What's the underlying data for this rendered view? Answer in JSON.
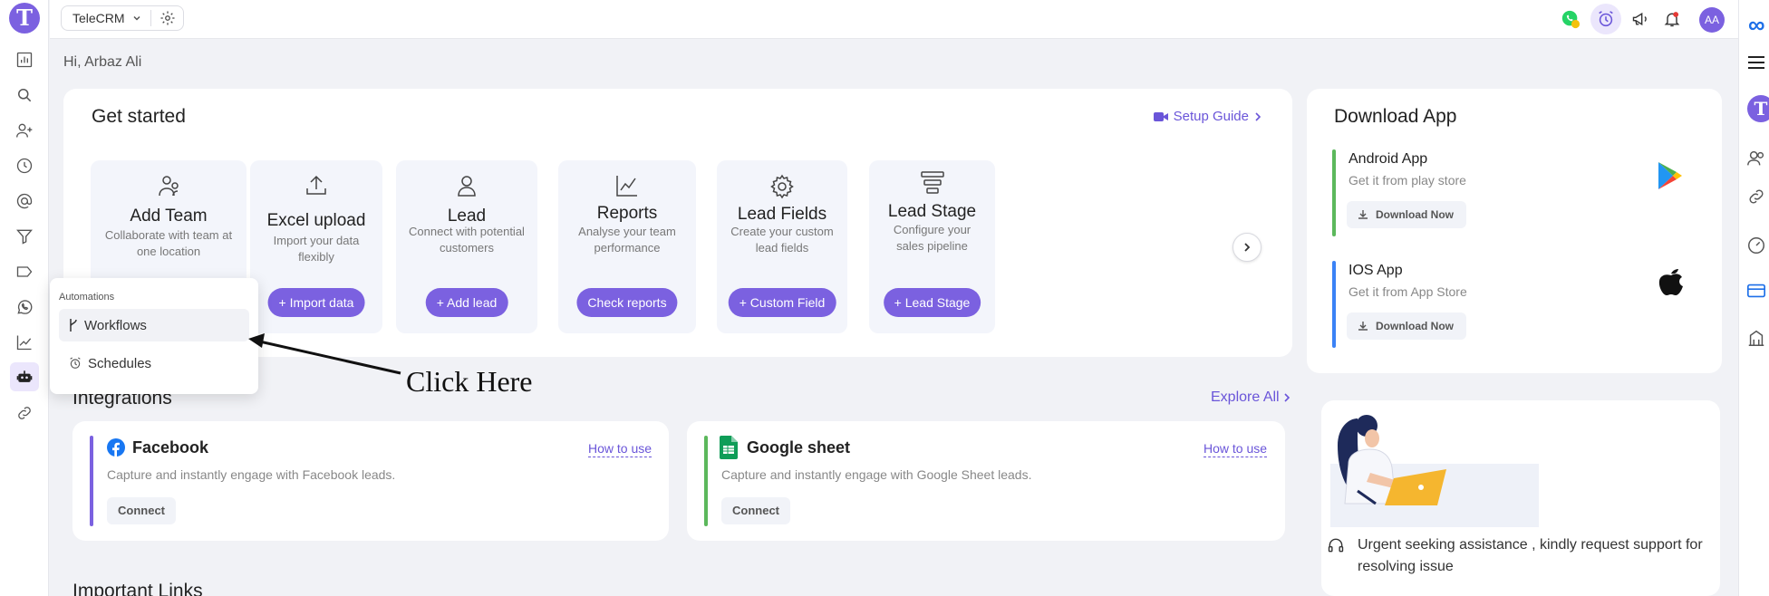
{
  "sidebar": {
    "logo": "T",
    "items": [
      {
        "icon": "bar-chart-icon"
      },
      {
        "icon": "search-icon"
      },
      {
        "icon": "add-user-icon"
      },
      {
        "icon": "clock-icon"
      },
      {
        "icon": "at-sign-icon"
      },
      {
        "icon": "filter-icon"
      },
      {
        "icon": "tag-icon"
      },
      {
        "icon": "whatsapp-icon"
      },
      {
        "icon": "trend-icon"
      },
      {
        "icon": "robot-icon"
      },
      {
        "icon": "link-icon"
      }
    ]
  },
  "header": {
    "workspace": "TeleCRM",
    "avatar": "AA",
    "icons": [
      "whatsapp-icon",
      "alarm-icon",
      "megaphone-icon",
      "bell-icon"
    ]
  },
  "greeting": "Hi, Arbaz Ali",
  "get_started": {
    "title": "Get started",
    "setup_guide": "Setup Guide",
    "tiles": [
      {
        "title": "Add Team",
        "desc": "Collaborate with team at one location",
        "button": "",
        "icon": "team-icon"
      },
      {
        "title": "Excel upload",
        "desc": "Import your data flexibly",
        "button": "+ Import data",
        "icon": "upload-icon"
      },
      {
        "title": "Lead",
        "desc": "Connect with potential customers",
        "button": "+ Add lead",
        "icon": "user-icon"
      },
      {
        "title": "Reports",
        "desc": "Analyse your team performance",
        "button": "Check reports",
        "icon": "line-chart-icon"
      },
      {
        "title": "Lead Fields",
        "desc": "Create your custom lead fields",
        "button": "+ Custom Field",
        "icon": "gear-icon"
      },
      {
        "title": "Lead Stage",
        "desc": "Configure your sales pipeline",
        "button": "+ Lead Stage",
        "icon": "funnel-stack-icon"
      }
    ]
  },
  "download_app": {
    "title": "Download App",
    "apps": [
      {
        "name": "Android App",
        "sub": "Get it from play store",
        "button": "Download Now",
        "color": "#5cb85c",
        "icon": "google-play-icon"
      },
      {
        "name": "IOS App",
        "sub": "Get it from App Store",
        "button": "Download Now",
        "color": "#3b82f6",
        "icon": "apple-icon"
      }
    ]
  },
  "integrations": {
    "title": "Integrations",
    "explore": "Explore All",
    "items": [
      {
        "name": "Facebook",
        "how": "How to use",
        "desc": "Capture and instantly engage with Facebook leads.",
        "button": "Connect",
        "color": "#7b61e0"
      },
      {
        "name": "Google sheet",
        "how": "How to use",
        "desc": "Capture and instantly engage with Google Sheet leads.",
        "button": "Connect",
        "color": "#5cb85c"
      }
    ]
  },
  "support": {
    "text": "Urgent seeking assistance , kindly request support for resolving issue"
  },
  "important_links": {
    "title": "Important Links"
  },
  "menu": {
    "header": "Automations",
    "items": [
      {
        "label": "Workflows",
        "icon": "branch-icon"
      },
      {
        "label": "Schedules",
        "icon": "alarm-icon"
      }
    ]
  },
  "annotation": "Click Here",
  "colors": {
    "accent": "#7b61e0",
    "link": "#6a55d9",
    "background": "#f1f2f6"
  }
}
